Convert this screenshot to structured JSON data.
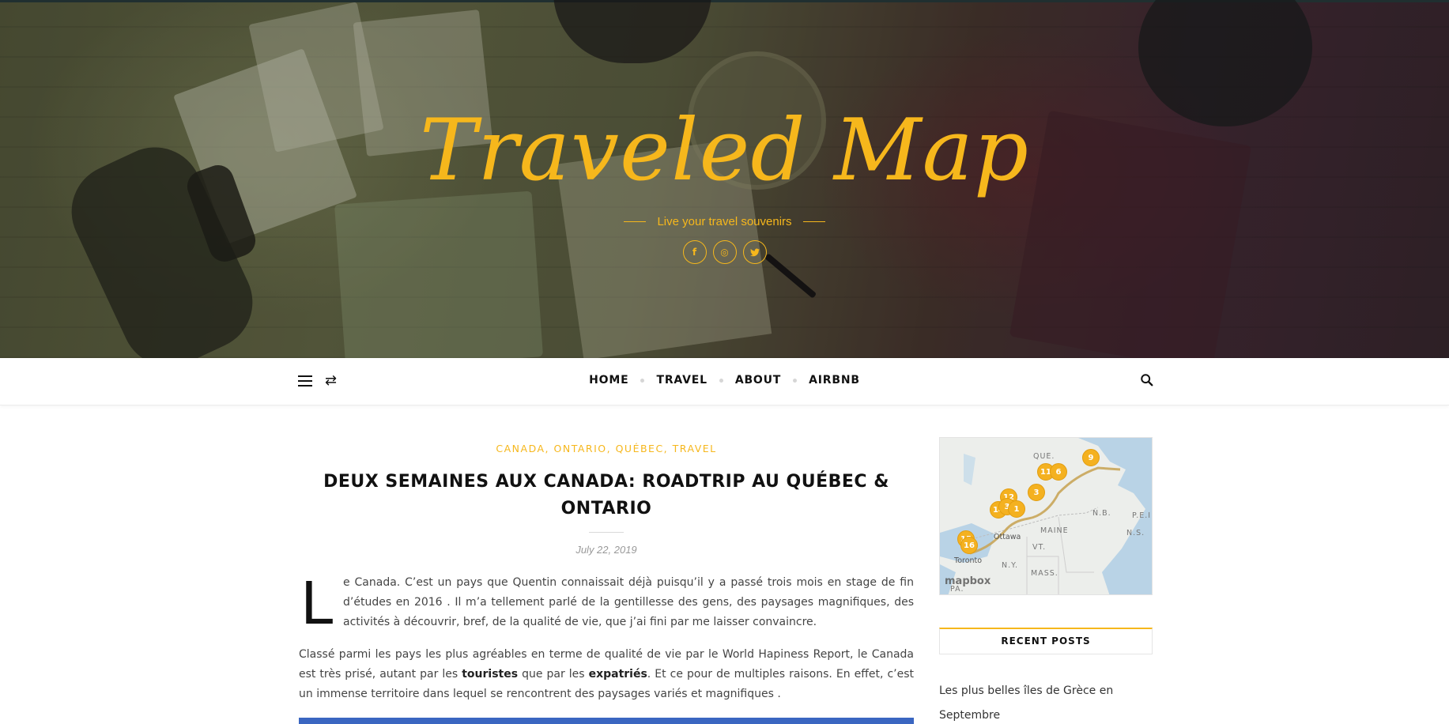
{
  "header": {
    "brand_title": "Traveled Map",
    "tagline": "Live your travel souvenirs",
    "socials": [
      {
        "name": "facebook",
        "glyph": "f"
      },
      {
        "name": "instagram",
        "glyph": "◎"
      },
      {
        "name": "twitter",
        "glyph": "🐦"
      }
    ],
    "accent_color": "#f6b71c"
  },
  "nav": {
    "items": [
      "HOME",
      "TRAVEL",
      "ABOUT",
      "AIRBNB"
    ],
    "left_icons": [
      "menu-icon",
      "random-post-icon"
    ],
    "right_icons": [
      "search-icon"
    ]
  },
  "post": {
    "categories": [
      "CANADA,",
      "ONTARIO,",
      "QUÉBEC,",
      "TRAVEL"
    ],
    "title": "DEUX SEMAINES AUX CANADA: ROADTRIP AU QUÉBEC & ONTARIO",
    "date": "July 22, 2019",
    "dropcap": "L",
    "intro": "e Canada. C’est un pays que Quentin connaissait déjà puisqu’il y a passé trois mois en stage de fin d’études en 2016 . Il m’a tellement parlé de la gentillesse des gens, des paysages magnifiques, des activités à découvrir, bref, de la qualité de vie, que j’ai fini par me laisser convaincre.",
    "p2_a": "Classé parmi les pays les plus agréables en terme de qualité de vie par le World Hapiness Report, le Canada est très prisé, autant par les ",
    "p2_b1": "touristes",
    "p2_c": " que par les ",
    "p2_b2": "expatriés",
    "p2_d": ". Et ce pour de multiples raisons. En effet, c’est un immense territoire dans lequel se rencontrent des paysages variés et magnifiques ."
  },
  "sidebar": {
    "map": {
      "labels": [
        "QUE.",
        "N.B.",
        "MAINE",
        "Ottawa",
        "P.E.I.",
        "N.S.",
        "VT.",
        "Toronto",
        "N.Y.",
        "MASS.",
        "PA."
      ],
      "pins": [
        "9",
        "11",
        "6",
        "12",
        "3",
        "14",
        "3",
        "1",
        "15",
        "16"
      ],
      "attribution": "mapbox"
    },
    "recent_posts_title": "RECENT POSTS",
    "recent_posts": [
      "Les plus belles îles de Grèce en Septembre"
    ]
  }
}
